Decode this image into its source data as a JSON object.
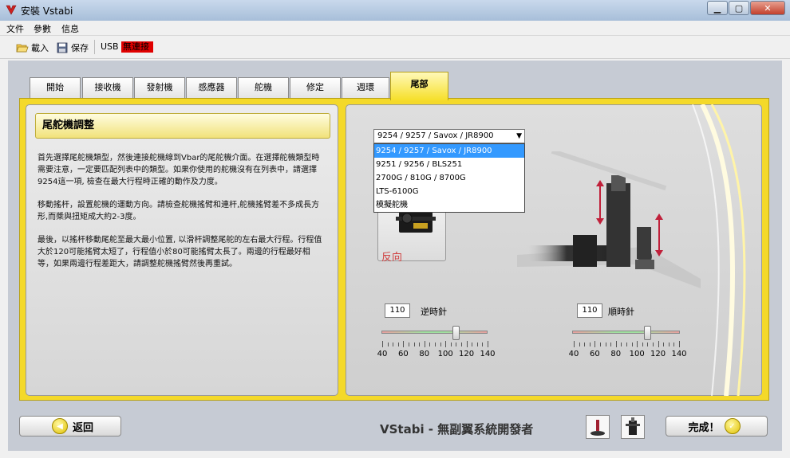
{
  "window": {
    "title": "安裝 Vstabi"
  },
  "menu": [
    "文件",
    "參數",
    "信息"
  ],
  "toolbar": {
    "load_label": "載入",
    "save_label": "保存",
    "usb_label": "USB",
    "status_text": "無連接"
  },
  "tabs": [
    {
      "label": "開始"
    },
    {
      "label": "接收機"
    },
    {
      "label": "發射機"
    },
    {
      "label": "感應器"
    },
    {
      "label": "舵機"
    },
    {
      "label": "修定"
    },
    {
      "label": "週環"
    },
    {
      "label": "尾部",
      "active": true
    }
  ],
  "left": {
    "section_title": "尾舵機調整",
    "p1": "首先選擇尾舵機類型，然後連接舵機線到Vbar的尾舵機介面。在選擇舵機類型時需要注意，一定要匹配列表中的類型。如果你使用的舵機沒有在列表中，請選擇9254這一項, 檢查在最大行程時正確的動作及力度。",
    "p2": "移動搖杆，設置舵機的運動方向。請檢查舵機搖臂和連杆,舵機搖臂差不多成長方形,而槳與扭矩成大約2-3度。",
    "p3": "最後，以搖杆移動尾舵至最大最小位置, 以滑杆調整尾舵的左右最大行程。行程值大於120可能搖臂太短了，行程值小於80可能搖臂太長了。兩邊的行程最好相等，如果兩邊行程差距大，請調整舵機搖臂然後再重試。"
  },
  "servo": {
    "selected": "9254 / 9257 / Savox / JR8900",
    "options": [
      "9254 / 9257 / Savox / JR8900",
      "9251 / 9256 / BLS251",
      "2700G / 810G / 8700G",
      "LTS-6100G",
      "模擬舵機"
    ],
    "reverse_label": "反向"
  },
  "travel": {
    "left": {
      "value": "110",
      "label": "逆時針",
      "level": 110
    },
    "right": {
      "value": "110",
      "label": "順時針",
      "level": 110
    },
    "scale": [
      "40",
      "60",
      "80",
      "100",
      "120",
      "140"
    ]
  },
  "footer": {
    "back_label": "返回",
    "brand": "VStabi - 無副翼系統開發者",
    "finish_label": "完成！"
  },
  "colors": {
    "accent_yellow": "#f4d92a",
    "status_red": "#e00000",
    "selection_blue": "#3399ff"
  }
}
